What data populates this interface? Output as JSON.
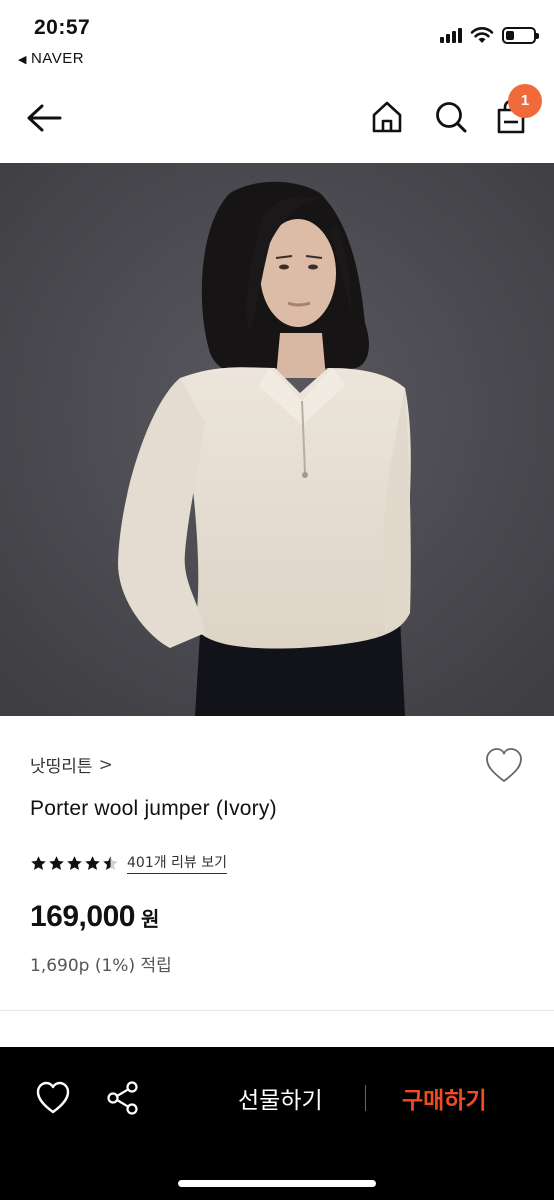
{
  "status_bar": {
    "time": "20:57",
    "back_app": "NAVER",
    "back_icon": "back-triangle-icon",
    "icons": [
      "cellular-signal-icon",
      "wifi-icon",
      "battery-icon"
    ]
  },
  "nav": {
    "back_icon": "arrow-left-icon",
    "home_icon": "home-icon",
    "search_icon": "search-icon",
    "cart_icon": "shopping-bag-icon",
    "cart_count": "1",
    "badge_color": "#f06a3a"
  },
  "product": {
    "image_alt": "woman-in-ivory-half-zip-jumper",
    "brand": "낫띵리튼",
    "brand_chevron": ">",
    "title": "Porter wool jumper (Ivory)",
    "rating": 4.5,
    "rating_max": 5,
    "review_link": "401개 리뷰 보기",
    "price": "169,000",
    "price_unit": "원",
    "points": "1,690p (1%) 적립"
  },
  "bottom_bar": {
    "wish_icon": "heart-icon",
    "share_icon": "share-icon",
    "gift_label": "선물하기",
    "buy_label": "구매하기",
    "buy_color": "#f04b24"
  }
}
